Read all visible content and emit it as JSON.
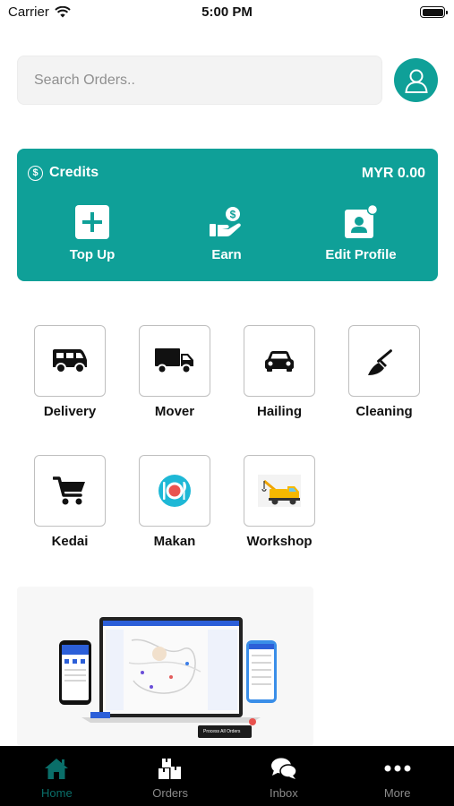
{
  "status_bar": {
    "carrier": "Carrier",
    "time": "5:00 PM"
  },
  "search": {
    "placeholder": "Search Orders.."
  },
  "credits": {
    "label": "Credits",
    "currency_symbol": "$",
    "amount": "MYR 0.00",
    "actions": [
      {
        "label": "Top Up",
        "icon": "plus-square-icon"
      },
      {
        "label": "Earn",
        "icon": "hand-coin-icon"
      },
      {
        "label": "Edit Profile",
        "icon": "profile-card-icon"
      }
    ]
  },
  "services": [
    {
      "label": "Delivery",
      "icon": "van-icon"
    },
    {
      "label": "Mover",
      "icon": "truck-icon"
    },
    {
      "label": "Hailing",
      "icon": "car-icon"
    },
    {
      "label": "Cleaning",
      "icon": "broom-icon"
    },
    {
      "label": "Kedai",
      "icon": "shopping-cart-icon"
    },
    {
      "label": "Makan",
      "icon": "plate-utensils-icon"
    },
    {
      "label": "Workshop",
      "icon": "tow-truck-icon"
    }
  ],
  "banner": {
    "chip_text": "Process All Orders"
  },
  "tabs": [
    {
      "label": "Home",
      "icon": "home-icon",
      "active": true
    },
    {
      "label": "Orders",
      "icon": "boxes-icon",
      "active": false
    },
    {
      "label": "Inbox",
      "icon": "chat-bubbles-icon",
      "active": false
    },
    {
      "label": "More",
      "icon": "ellipsis-icon",
      "active": false
    }
  ],
  "colors": {
    "brand": "#0fa098",
    "tab_bar": "#000000",
    "active_tab": "#0a6e69"
  }
}
